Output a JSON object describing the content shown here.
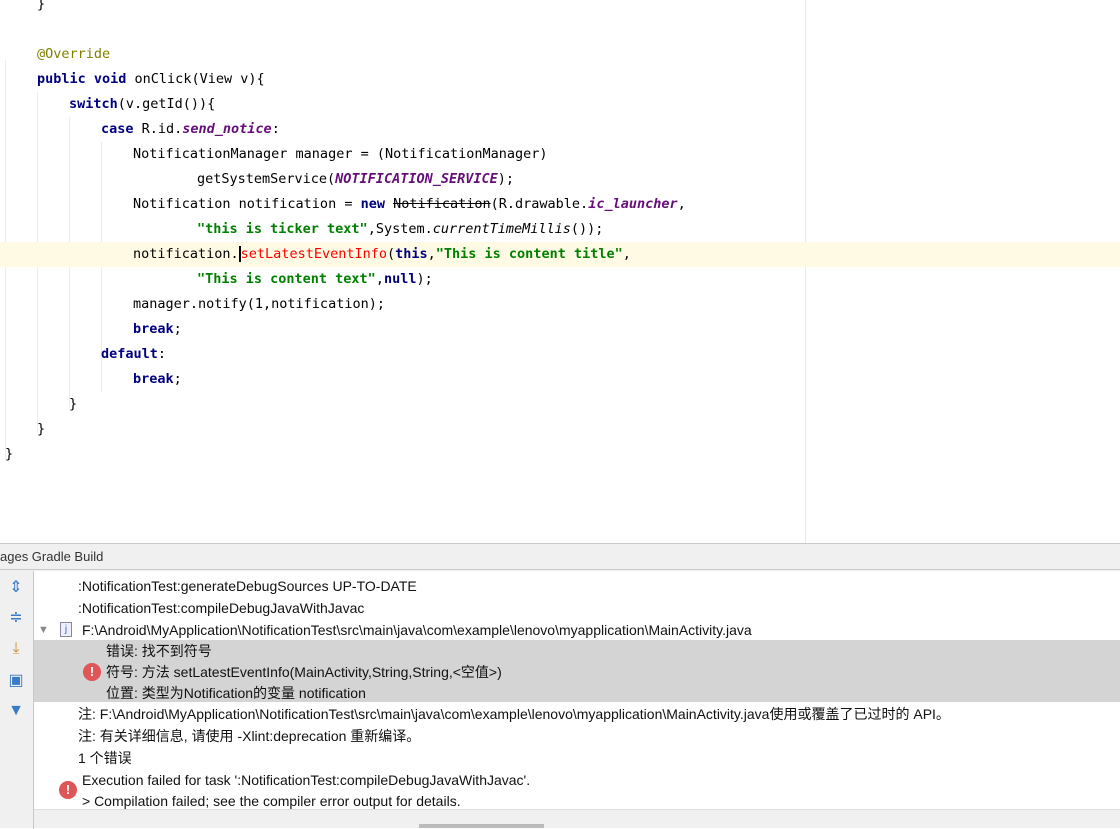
{
  "editor": {
    "lines": [
      {
        "indent": 37,
        "tokens": [
          {
            "t": "}",
            "c": ""
          }
        ]
      },
      {
        "indent": 0,
        "tokens": []
      },
      {
        "indent": 37,
        "tokens": [
          {
            "t": "@Override",
            "c": "ann"
          }
        ]
      },
      {
        "indent": 37,
        "tokens": [
          {
            "t": "public void ",
            "c": "kw"
          },
          {
            "t": "onClick(View v){",
            "c": ""
          }
        ]
      },
      {
        "indent": 69,
        "tokens": [
          {
            "t": "switch",
            "c": "kw"
          },
          {
            "t": "(v.getId()){",
            "c": ""
          }
        ]
      },
      {
        "indent": 101,
        "tokens": [
          {
            "t": "case ",
            "c": "kw"
          },
          {
            "t": "R.id.",
            "c": ""
          },
          {
            "t": "send_notice",
            "c": "field"
          },
          {
            "t": ":",
            "c": ""
          }
        ]
      },
      {
        "indent": 133,
        "tokens": [
          {
            "t": "NotificationManager manager = (NotificationManager)",
            "c": ""
          }
        ]
      },
      {
        "indent": 197,
        "tokens": [
          {
            "t": "getSystemService(",
            "c": ""
          },
          {
            "t": "NOTIFICATION_SERVICE",
            "c": "field"
          },
          {
            "t": ");",
            "c": ""
          }
        ]
      },
      {
        "indent": 133,
        "tokens": [
          {
            "t": "Notification notification = ",
            "c": ""
          },
          {
            "t": "new ",
            "c": "kw"
          },
          {
            "t": "Notification",
            "c": "strike"
          },
          {
            "t": "(R.drawable.",
            "c": ""
          },
          {
            "t": "ic_launcher",
            "c": "field"
          },
          {
            "t": ",",
            "c": ""
          }
        ]
      },
      {
        "indent": 197,
        "tokens": [
          {
            "t": "\"this is ticker text\"",
            "c": "str"
          },
          {
            "t": ",System.",
            "c": ""
          },
          {
            "t": "currentTimeMillis",
            "c": "ital"
          },
          {
            "t": "());",
            "c": ""
          }
        ]
      },
      {
        "indent": 133,
        "highlight": true,
        "tokens": [
          {
            "t": "notification.",
            "c": ""
          },
          {
            "t": "setLatestEventInfo",
            "c": "err caret"
          },
          {
            "t": "(",
            "c": ""
          },
          {
            "t": "this",
            "c": "kw"
          },
          {
            "t": ",",
            "c": ""
          },
          {
            "t": "\"This is content title\"",
            "c": "str"
          },
          {
            "t": ",",
            "c": ""
          }
        ]
      },
      {
        "indent": 197,
        "tokens": [
          {
            "t": "\"This is content text\"",
            "c": "str"
          },
          {
            "t": ",",
            "c": ""
          },
          {
            "t": "null",
            "c": "kw"
          },
          {
            "t": ");",
            "c": ""
          }
        ]
      },
      {
        "indent": 133,
        "tokens": [
          {
            "t": "manager.notify(1,notification);",
            "c": ""
          }
        ]
      },
      {
        "indent": 133,
        "tokens": [
          {
            "t": "break",
            "c": "kw"
          },
          {
            "t": ";",
            "c": ""
          }
        ]
      },
      {
        "indent": 101,
        "tokens": [
          {
            "t": "default",
            "c": "kw"
          },
          {
            "t": ":",
            "c": ""
          }
        ]
      },
      {
        "indent": 133,
        "tokens": [
          {
            "t": "break",
            "c": "kw"
          },
          {
            "t": ";",
            "c": ""
          }
        ]
      },
      {
        "indent": 69,
        "tokens": [
          {
            "t": "}",
            "c": ""
          }
        ]
      },
      {
        "indent": 37,
        "tokens": [
          {
            "t": "}",
            "c": ""
          }
        ]
      },
      {
        "indent": 5,
        "tokens": [
          {
            "t": "}",
            "c": ""
          }
        ]
      }
    ]
  },
  "panel": {
    "title": "ages Gradle Build",
    "rows": {
      "r0": ":NotificationTest:generateDebugSources UP-TO-DATE",
      "r1": ":NotificationTest:compileDebugJavaWithJavac",
      "file": "F:\\Android\\MyApplication\\NotificationTest\\src\\main\\java\\com\\example\\lenovo\\myapplication\\MainActivity.java",
      "err1": "错误: 找不到符号",
      "err2": "符号:   方法 setLatestEventInfo(MainActivity,String,String,<空值>)",
      "err3": "位置: 类型为Notification的变量 notification",
      "note1": "注: F:\\Android\\MyApplication\\NotificationTest\\src\\main\\java\\com\\example\\lenovo\\myapplication\\MainActivity.java使用或覆盖了已过时的 API。",
      "note2": "注: 有关详细信息, 请使用 -Xlint:deprecation 重新编译。",
      "count": "1 个错误",
      "exec1": "Execution failed for task ':NotificationTest:compileDebugJavaWithJavac'.",
      "exec2": "> Compilation failed; see the compiler error output for details."
    },
    "toolbar_icons": [
      "expand-all-icon",
      "collapse-all-icon",
      "export-icon",
      "autoscroll-icon",
      "filter-icon"
    ]
  },
  "colors": {
    "error": "#e05555",
    "highlight_line": "#fffae3",
    "selection": "#d4d4d4"
  }
}
